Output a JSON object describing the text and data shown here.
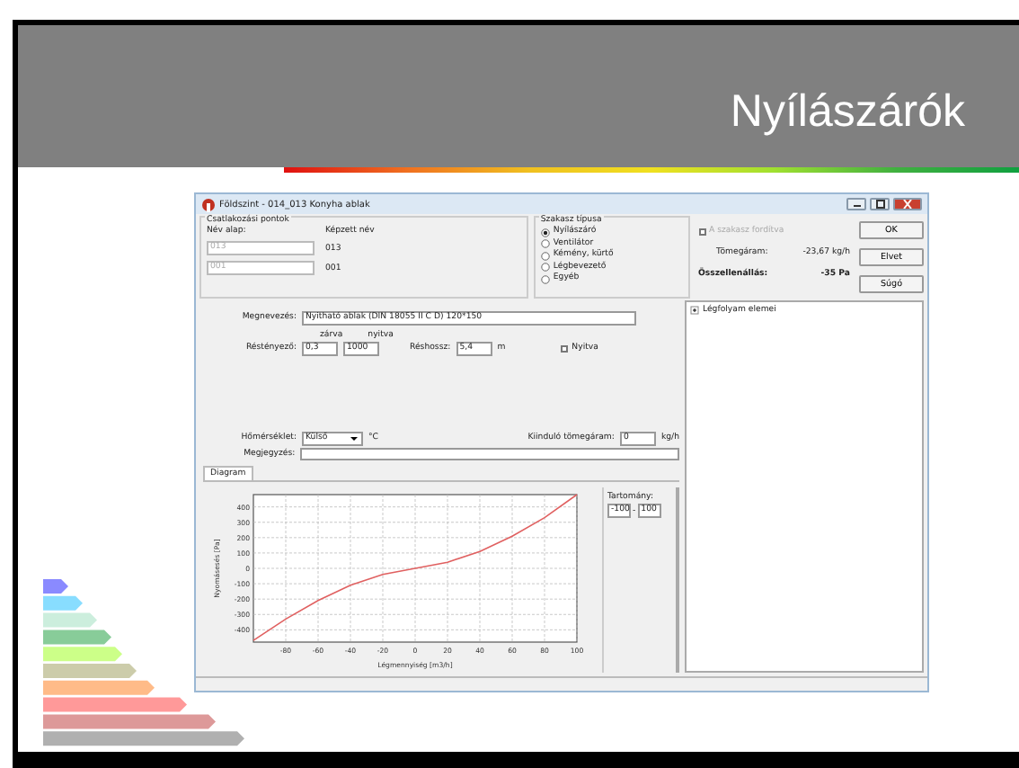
{
  "slide": {
    "title": "Nyílászárók"
  },
  "window": {
    "title": "Földszint - 014_013 Konyha ablak"
  },
  "connection_points": {
    "title": "Csatlakozási pontok",
    "name_base_label": "Név alap:",
    "derived_name_label": "Képzett név",
    "rows": [
      {
        "base": "013",
        "derived": "013"
      },
      {
        "base": "001",
        "derived": "001"
      }
    ]
  },
  "section_type": {
    "title": "Szakasz típusa",
    "options": [
      {
        "label": "Nyílászáró",
        "selected": true
      },
      {
        "label": "Ventilátor",
        "selected": false
      },
      {
        "label": "Kémény, kürtő",
        "selected": false
      },
      {
        "label": "Légbevezető",
        "selected": false
      },
      {
        "label": "Egyéb",
        "selected": false
      }
    ]
  },
  "summary": {
    "reverse": {
      "label": "A szakasz fordítva",
      "checked": false,
      "disabled": true
    },
    "mass_flow_label": "Tömegáram:",
    "mass_flow": "-23,67 kg/h",
    "total_resistance_label": "Összellenállás:",
    "total_resistance": "-35 Pa"
  },
  "buttons": [
    "OK",
    "Elvet",
    "Súgó"
  ],
  "form": {
    "name_label": "Megnevezés:",
    "name": "Nyitható ablak (DIN 18055 II C D) 120*150",
    "closed_label": "zárva",
    "open_label": "nyitva",
    "gap_factor_label": "Réstényező:",
    "gap_closed": "0,3",
    "gap_open": "1000",
    "gap_length_label": "Réshossz:",
    "gap_length": "5,4",
    "gap_length_unit": "m",
    "open_checkbox": {
      "label": "Nyitva",
      "checked": false
    },
    "temperature_label": "Hőmérséklet:",
    "temperature": "Külső",
    "temperature_unit": "°C",
    "initial_flow_label": "Kiinduló tömegáram:",
    "initial_flow": "0",
    "initial_flow_unit": "kg/h",
    "note_label": "Megjegyzés:"
  },
  "tabs": [
    {
      "label": "Diagram",
      "selected": true
    }
  ],
  "range": {
    "label": "Tartomány:",
    "from": "-100",
    "separator": "-",
    "to": "100"
  },
  "chart_data": {
    "type": "line",
    "xlabel": "Légmennyiség [m3/h]",
    "ylabel": "Nyomásesés [Pa]",
    "x": [
      -100,
      -80,
      -60,
      -40,
      -20,
      0,
      20,
      40,
      60,
      80,
      100
    ],
    "grid": true,
    "series": [
      {
        "color": "#e06060",
        "values": [
          -470,
          -330,
          -210,
          -110,
          -40,
          0,
          40,
          110,
          210,
          330,
          480
        ]
      }
    ],
    "xlim": [
      -100,
      100
    ],
    "ylim": [
      -480,
      480
    ],
    "xticks": [
      -80,
      -60,
      -40,
      -20,
      0,
      20,
      40,
      60,
      80,
      100
    ],
    "yticks": [
      -400,
      -300,
      -200,
      -100,
      0,
      100,
      200,
      300,
      400
    ]
  },
  "tree": {
    "items": [
      {
        "label": "Légfolyam elemei",
        "expanded": false
      }
    ]
  }
}
